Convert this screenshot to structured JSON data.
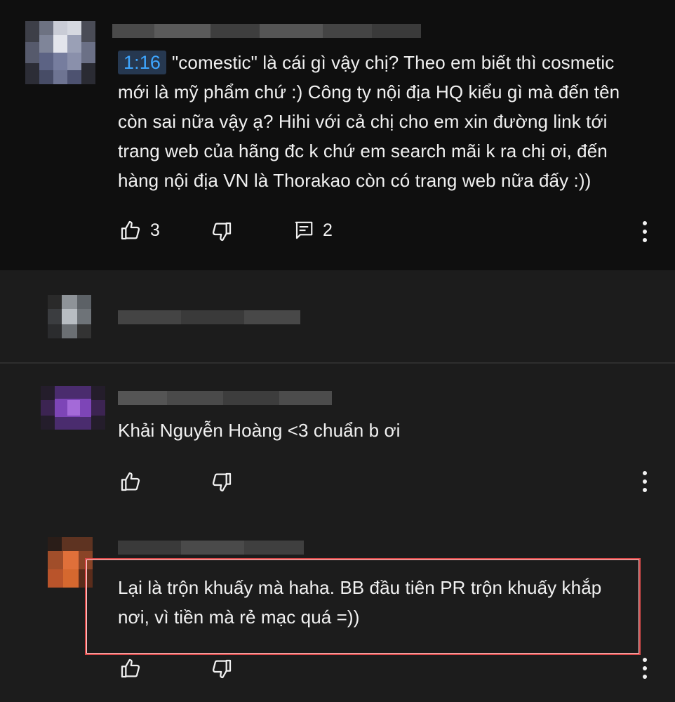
{
  "comments": [
    {
      "timestamp": "1:16",
      "text_line1": "\"comestic\" là cái gì vậy chị? Theo em biết thì cosmetic",
      "text_line2": "mới là mỹ phẩm chứ :) Công ty nội địa HQ kiểu gì mà đến tên",
      "text_line3": "còn sai nữa vậy ạ? Hihi với cả chị cho em xin đường link tới",
      "text_line4": "trang web của hãng đc k chứ em search mãi k ra chị ơi, đến",
      "text_line5": "hàng nội địa VN là Thorakao còn có trang web nữa đấy :))",
      "likes": "3",
      "replies": "2"
    },
    {
      "text": "Khải Nguyễn Hoàng <3 chuẩn b ơi"
    },
    {
      "text_line1": "Lại là trộn khuấy mà haha. BB đầu tiên PR trộn khuấy khắp",
      "text_line2": "nơi, vì tiền mà rẻ mạc quá =))"
    }
  ],
  "icons": {
    "like": "thumbs-up-icon",
    "dislike": "thumbs-down-icon",
    "reply": "comment-icon",
    "menu": "more-vert-icon"
  },
  "colors": {
    "timestamp_bg": "#263850",
    "timestamp_text": "#3ea6ff",
    "highlight_border": "#d94a4a"
  }
}
